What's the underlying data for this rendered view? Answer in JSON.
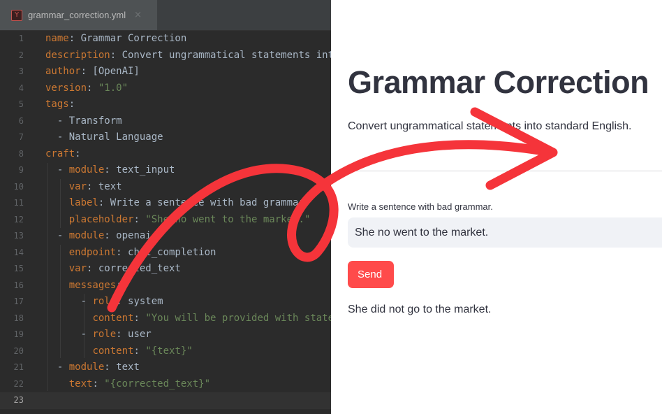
{
  "editor": {
    "tab": {
      "filename": "grammar_correction.yml",
      "icon": "yaml-file-icon",
      "close_glyph": "×"
    },
    "current_line": 23,
    "lines": [
      [
        [
          "k",
          "name"
        ],
        [
          "p",
          ": Grammar Correction"
        ]
      ],
      [
        [
          "k",
          "description"
        ],
        [
          "p",
          ": Convert ungrammatical statements into standard English."
        ]
      ],
      [
        [
          "k",
          "author"
        ],
        [
          "p",
          ": [OpenAI]"
        ]
      ],
      [
        [
          "k",
          "version"
        ],
        [
          "p",
          ": "
        ],
        [
          "s",
          "\"1.0\""
        ]
      ],
      [
        [
          "k",
          "tags"
        ],
        [
          "p",
          ":"
        ]
      ],
      [
        [
          "p",
          "  - Transform"
        ]
      ],
      [
        [
          "p",
          "  - Natural Language"
        ]
      ],
      [
        [
          "k",
          "craft"
        ],
        [
          "p",
          ":"
        ]
      ],
      [
        [
          "p",
          "  - "
        ],
        [
          "k",
          "module"
        ],
        [
          "p",
          ": text_input"
        ]
      ],
      [
        [
          "p",
          "    "
        ],
        [
          "k",
          "var"
        ],
        [
          "p",
          ": text"
        ]
      ],
      [
        [
          "p",
          "    "
        ],
        [
          "k",
          "label"
        ],
        [
          "p",
          ": Write a sentence with bad grammar."
        ]
      ],
      [
        [
          "p",
          "    "
        ],
        [
          "k",
          "placeholder"
        ],
        [
          "p",
          ": "
        ],
        [
          "s",
          "\"She no went to the market.\""
        ]
      ],
      [
        [
          "p",
          "  - "
        ],
        [
          "k",
          "module"
        ],
        [
          "p",
          ": openai"
        ]
      ],
      [
        [
          "p",
          "    "
        ],
        [
          "k",
          "endpoint"
        ],
        [
          "p",
          ": chat_completion"
        ]
      ],
      [
        [
          "p",
          "    "
        ],
        [
          "k",
          "var"
        ],
        [
          "p",
          ": corrected_text"
        ]
      ],
      [
        [
          "p",
          "    "
        ],
        [
          "k",
          "messages"
        ],
        [
          "p",
          ":"
        ]
      ],
      [
        [
          "p",
          "      - "
        ],
        [
          "k",
          "role"
        ],
        [
          "p",
          ": system"
        ]
      ],
      [
        [
          "p",
          "        "
        ],
        [
          "k",
          "content"
        ],
        [
          "p",
          ": "
        ],
        [
          "s",
          "\"You will be provided with statements, and your task is to convert them to standard English.\""
        ]
      ],
      [
        [
          "p",
          "      - "
        ],
        [
          "k",
          "role"
        ],
        [
          "p",
          ": user"
        ]
      ],
      [
        [
          "p",
          "        "
        ],
        [
          "k",
          "content"
        ],
        [
          "p",
          ": "
        ],
        [
          "s",
          "\"{text}\""
        ]
      ],
      [
        [
          "p",
          "  - "
        ],
        [
          "k",
          "module"
        ],
        [
          "p",
          ": text"
        ]
      ],
      [
        [
          "p",
          "    "
        ],
        [
          "k",
          "text"
        ],
        [
          "p",
          ": "
        ],
        [
          "s",
          "\"{corrected_text}\""
        ]
      ],
      [
        [
          "p",
          ""
        ]
      ]
    ]
  },
  "app": {
    "title": "Grammar Correction",
    "description": "Convert ungrammatical statements into standard English.",
    "input_label": "Write a sentence with bad grammar.",
    "input_value": "She no went to the market.",
    "submit_label": "Send",
    "output": "She did not go to the market."
  },
  "colors": {
    "accent": "#ff4b4b",
    "arrow": "#f5343a",
    "editor_bg": "#2b2b2b",
    "keyword": "#cc7832",
    "string": "#6a8759"
  }
}
